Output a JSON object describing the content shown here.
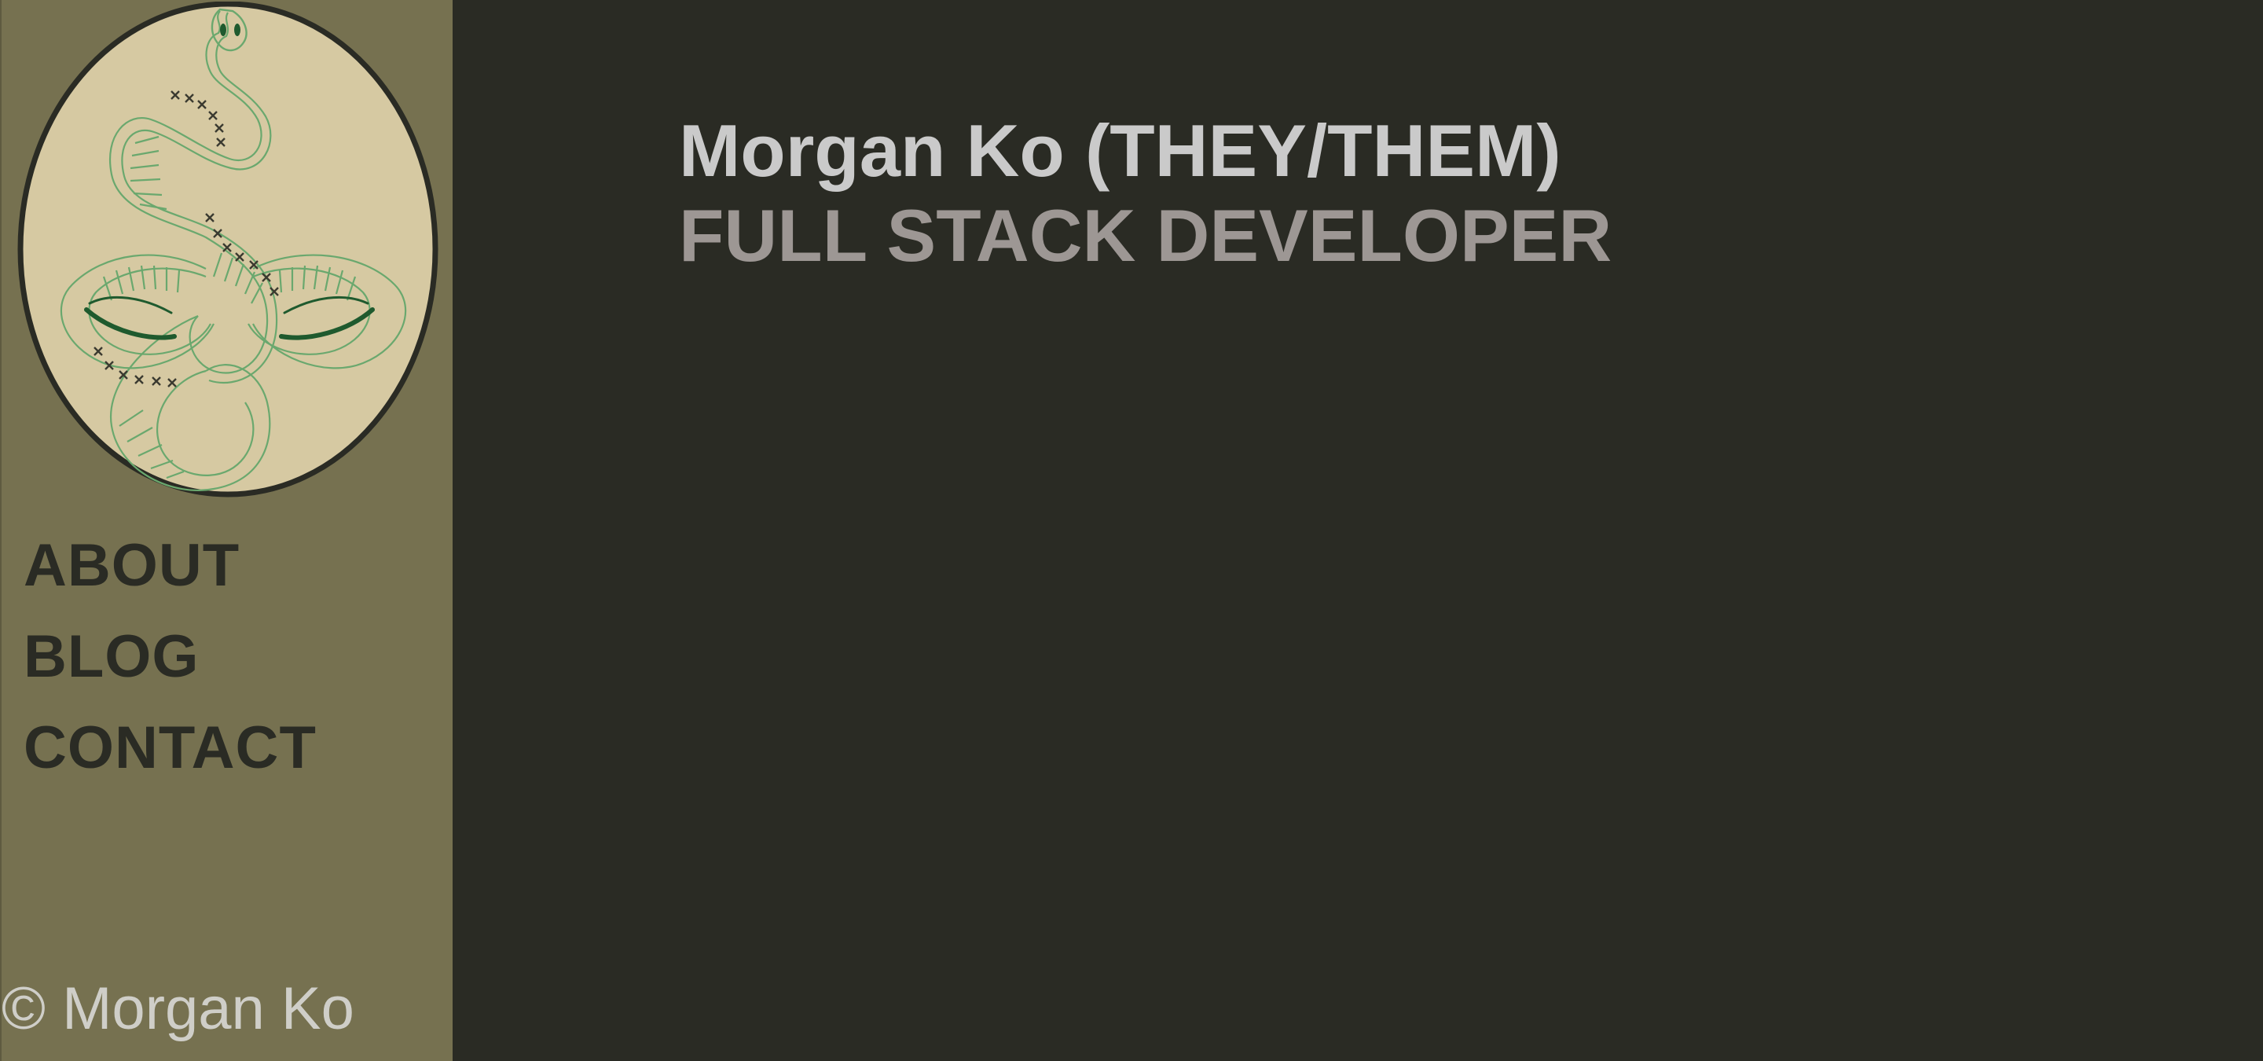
{
  "header": {
    "name": "Morgan Ko (THEY/THEM)",
    "role": "FULL STACK DEVELOPER"
  },
  "sidebar": {
    "logo_icon": "snake-logo-icon",
    "nav": [
      {
        "label": "ABOUT"
      },
      {
        "label": "BLOG"
      },
      {
        "label": "CONTACT"
      }
    ],
    "footer": "© Morgan Ko"
  },
  "colors": {
    "background": "#2a2b24",
    "sidebar": "#767150",
    "logo_fill": "#d6c9a2",
    "snake_line": "#6aa86e",
    "accent_dark_green": "#1f5a2e"
  }
}
